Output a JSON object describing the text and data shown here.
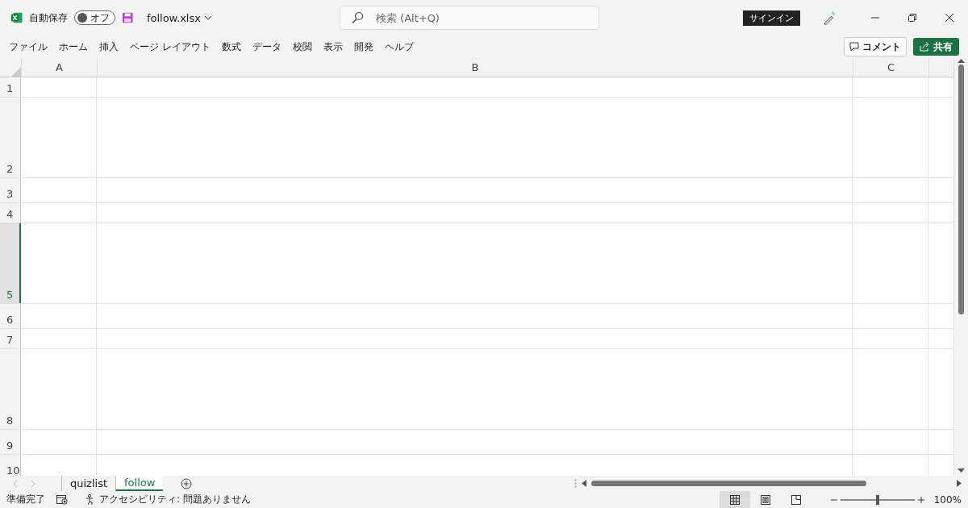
{
  "title_bar": {
    "autosave_label": "自動保存",
    "autosave": {
      "on": false,
      "label": "オフ"
    },
    "file_name": "follow.xlsx",
    "search": {
      "placeholder": "検索 (Alt+Q)"
    },
    "sign_in": "サインイン"
  },
  "ribbon_tabs": [
    {
      "label": "ファイル"
    },
    {
      "label": "ホーム"
    },
    {
      "label": "挿入"
    },
    {
      "label": "ページ レイアウト"
    },
    {
      "label": "数式"
    },
    {
      "label": "データ"
    },
    {
      "label": "校閲"
    },
    {
      "label": "表示"
    },
    {
      "label": "開発"
    },
    {
      "label": "ヘルプ"
    }
  ],
  "comment_button": "コメント",
  "share_button": "共有",
  "columns": [
    {
      "label": "A",
      "kind": "normal"
    },
    {
      "label": "B",
      "kind": "wide"
    },
    {
      "label": "C",
      "kind": "normal"
    }
  ],
  "rows": [
    {
      "label": "1",
      "kind": "short",
      "selected": false
    },
    {
      "label": "2",
      "kind": "tall",
      "selected": false
    },
    {
      "label": "3",
      "kind": "medium",
      "selected": false
    },
    {
      "label": "4",
      "kind": "short",
      "selected": false
    },
    {
      "label": "5",
      "kind": "tall",
      "selected": true
    },
    {
      "label": "6",
      "kind": "medium",
      "selected": false
    },
    {
      "label": "7",
      "kind": "short",
      "selected": false
    },
    {
      "label": "8",
      "kind": "tall",
      "selected": false
    },
    {
      "label": "9",
      "kind": "medium",
      "selected": false
    },
    {
      "label": "10",
      "kind": "medium",
      "selected": false
    }
  ],
  "sheet_tabs": [
    {
      "label": "quizlist",
      "selected": false
    },
    {
      "label": "follow",
      "selected": true
    }
  ],
  "status_bar": {
    "status": "準備完了",
    "accessibility": "アクセシビリティ: 問題ありません",
    "views": [
      {
        "kind": "normal",
        "selected": true
      },
      {
        "kind": "page_layout",
        "selected": false
      },
      {
        "kind": "page_break",
        "selected": false
      }
    ],
    "zoom": {
      "level": 0.5,
      "reading": "100%"
    }
  }
}
